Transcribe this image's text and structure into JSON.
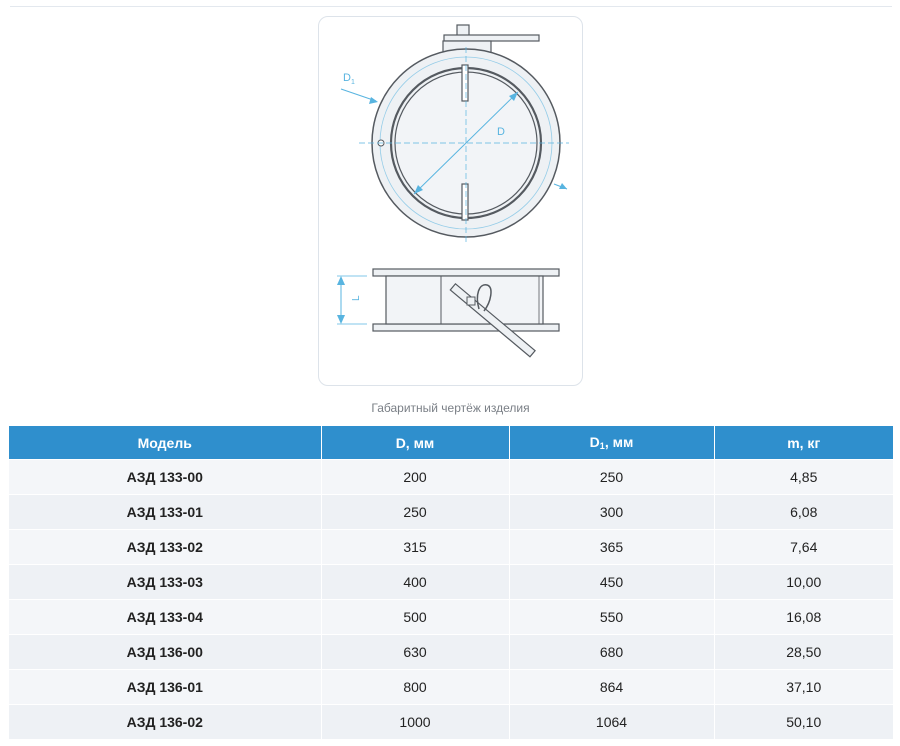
{
  "drawing": {
    "label_d1": "D",
    "label_d1_sub": "1",
    "label_d": "D",
    "label_l": "L",
    "caption": "Габаритный чертёж изделия"
  },
  "table": {
    "headers": {
      "model": "Модель",
      "d": "D, мм",
      "d1_main": "D",
      "d1_sub": "1",
      "d1_unit": ", мм",
      "m": "m, кг"
    },
    "rows": [
      {
        "model": "АЗД 133-00",
        "d": "200",
        "d1": "250",
        "m": "4,85"
      },
      {
        "model": "АЗД 133-01",
        "d": "250",
        "d1": "300",
        "m": "6,08"
      },
      {
        "model": "АЗД 133-02",
        "d": "315",
        "d1": "365",
        "m": "7,64"
      },
      {
        "model": "АЗД 133-03",
        "d": "400",
        "d1": "450",
        "m": "10,00"
      },
      {
        "model": "АЗД 133-04",
        "d": "500",
        "d1": "550",
        "m": "16,08"
      },
      {
        "model": "АЗД 136-00",
        "d": "630",
        "d1": "680",
        "m": "28,50"
      },
      {
        "model": "АЗД 136-01",
        "d": "800",
        "d1": "864",
        "m": "37,10"
      },
      {
        "model": "АЗД 136-02",
        "d": "1000",
        "d1": "1064",
        "m": "50,10"
      }
    ]
  },
  "colors": {
    "header_bg": "#2f8fcd",
    "dimension_blue": "#58b4e0",
    "drawing_line": "#555a60",
    "metal_fill": "#eef1f4"
  }
}
